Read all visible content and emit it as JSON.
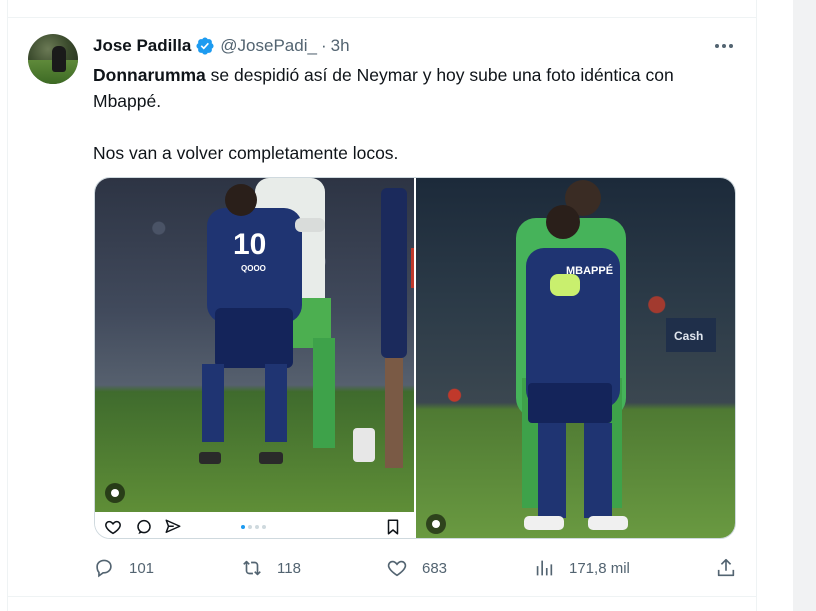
{
  "tweet": {
    "author_name": "Jose Padilla",
    "author_handle": "@JosePadi_",
    "separator": "·",
    "time": "3h",
    "text_bold": "Donnarumma",
    "text_line1_rest": " se despidió así de Neymar y hoy sube una foto idéntica con Mbappé.",
    "text_paragraph2": "Nos van a volver completamente locos.",
    "left_photo": {
      "shirt_number": "10",
      "sponsor": "QOOO"
    },
    "right_photo": {
      "shirt_name": "MBAPPÉ",
      "ad_board": "Cash"
    },
    "counts": {
      "replies": "101",
      "reposts": "118",
      "likes": "683",
      "views": "171,8 mil"
    }
  },
  "colors": {
    "verified_badge": "#1d9bf0",
    "secondary_text": "#536471",
    "carousel_active_dot": "#1d9bf0"
  },
  "icons": {
    "reply": "speech-bubble-icon",
    "repost": "repost-arrows-icon",
    "like": "heart-icon",
    "views": "bar-chart-icon",
    "share": "share-upload-icon",
    "more": "ellipsis-icon",
    "verified": "verified-badge-icon"
  }
}
